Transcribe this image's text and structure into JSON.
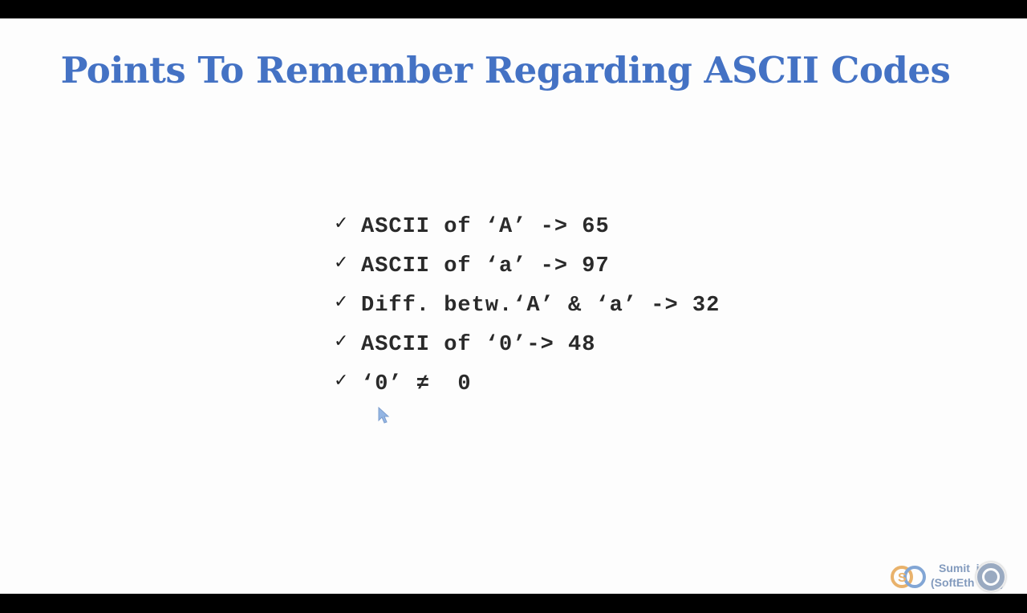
{
  "slide": {
    "title": "Points To Remember Regarding ASCII Codes",
    "bullets": [
      {
        "check": "✓",
        "text": "ASCII of ‘A’ -> 65"
      },
      {
        "check": "✓",
        "text": "ASCII of ‘a’ -> 97"
      },
      {
        "check": "✓",
        "text": "Diff. betw.‘A’ & ‘a’ -> 32"
      },
      {
        "check": "✓",
        "text": "ASCII of ‘0’-> 48"
      },
      {
        "check": "✓",
        "text": "‘0’ ≠  0"
      }
    ]
  },
  "watermark": {
    "line1": "Sumit  i",
    "line2": "(SoftEth   ch.)",
    "icon": "softeth-logo-icon",
    "avatar_icon": "presenter-avatar-icon"
  },
  "colors": {
    "title": "#4472c4",
    "text": "#2a2a2a",
    "background": "#fdfdfd",
    "letterbox": "#000000"
  }
}
